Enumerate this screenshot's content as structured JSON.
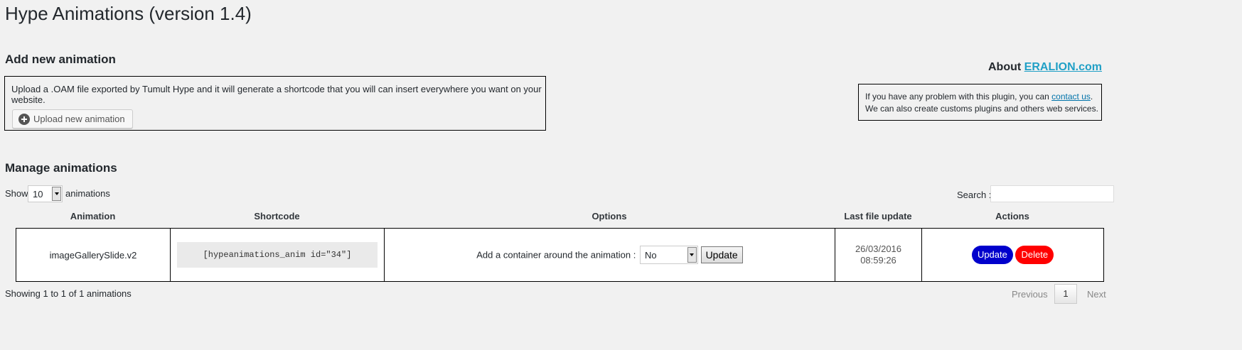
{
  "page_title": "Hype Animations (version 1.4)",
  "add_section": {
    "heading": "Add new animation",
    "description": "Upload a .OAM file exported by Tumult Hype and it will generate a shortcode that you will can insert everywhere you want on your website.",
    "upload_button": "Upload new animation",
    "upload_icon": "plus-circle-icon"
  },
  "about": {
    "prefix": "About",
    "link_text": "ERALION.com",
    "line1_prefix": "If you have any problem with this plugin, you can",
    "contact_link": "contact us",
    "line1_suffix": ".",
    "line2": "We can also create customs plugins and others web services."
  },
  "manage": {
    "heading": "Manage animations",
    "show_label": "Show",
    "page_size": "10",
    "animations_label": "animations",
    "search_label": "Search :",
    "search_value": "",
    "columns": [
      "Animation",
      "Shortcode",
      "Options",
      "Last file update",
      "Actions"
    ],
    "rows": [
      {
        "animation": "imageGallerySlide.v2",
        "shortcode": "[hypeanimations_anim id=\"34\"]",
        "option_label": "Add a container around the animation :",
        "option_value": "No",
        "option_button": "Update",
        "date": "26/03/2016",
        "time": "08:59:26",
        "update_label": "Update",
        "delete_label": "Delete"
      }
    ],
    "info": "Showing 1 to 1 of 1 animations",
    "previous": "Previous",
    "page": "1",
    "next": "Next"
  },
  "colors": {
    "background": "#f1f1f1",
    "link": "#21a0c6",
    "update_pill": "#0000cc",
    "delete_pill": "#ff0000"
  }
}
